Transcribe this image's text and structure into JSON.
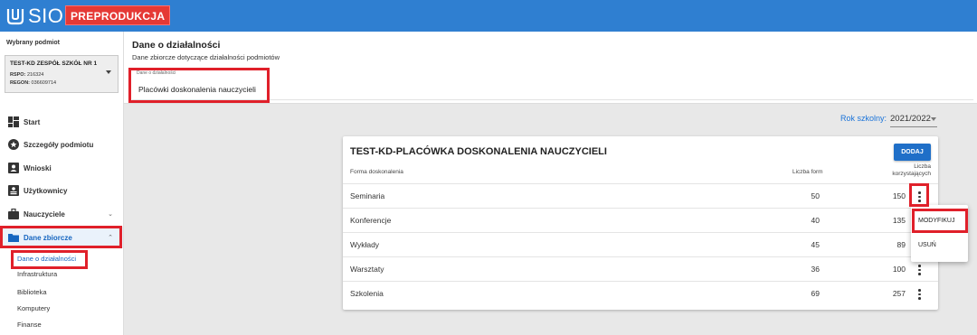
{
  "app": {
    "logo_text": "SIO",
    "environment_badge": "PREPRODUKCJA",
    "brand_color": "#2f7fd1",
    "badge_color": "#e53935"
  },
  "sidebar": {
    "caption": "Wybrany podmiot",
    "entity": {
      "name": "TEST-KD ZESPÓŁ SZKÓŁ NR 1",
      "rspo_label": "RSPO:",
      "rspo_value": "216324",
      "regon_label": "REGON:",
      "regon_value": "036609714"
    },
    "nav": [
      {
        "label": "Start",
        "icon": "dashboard-icon"
      },
      {
        "label": "Szczegóły podmiotu",
        "icon": "star-badge-icon"
      },
      {
        "label": "Wnioski",
        "icon": "person-card-icon"
      },
      {
        "label": "Użytkownicy",
        "icon": "id-badge-icon"
      },
      {
        "label": "Nauczyciele",
        "icon": "briefcase-icon",
        "expandable": true
      },
      {
        "label": "Dane zbiorcze",
        "icon": "folder-icon",
        "expandable": true,
        "expanded": true,
        "active": true
      }
    ],
    "subnav": [
      {
        "label": "Dane o działalności",
        "active": true
      },
      {
        "label": "Infrastruktura"
      },
      {
        "label": "Biblioteka"
      },
      {
        "label": "Komputery"
      },
      {
        "label": "Finanse"
      }
    ]
  },
  "header": {
    "title": "Dane o działalności",
    "subtitle": "Dane zbiorcze dotyczące działalności podmiotów",
    "select_caption": "Dane o działalności",
    "select_value": "Placówki doskonalenia nauczycieli"
  },
  "school_year": {
    "label": "Rok szkolny:",
    "value": "2021/2022"
  },
  "card": {
    "title": "TEST-KD-PLACÓWKA DOSKONALENIA NAUCZYCIELI",
    "add_button": "DODAJ",
    "columns": {
      "form": "Forma doskonalenia",
      "count": "Liczba form",
      "users_line1": "Liczba",
      "users_line2": "korzystających"
    },
    "rows": [
      {
        "form": "Seminaria",
        "count": "50",
        "users": "150"
      },
      {
        "form": "Konferencje",
        "count": "40",
        "users": "135"
      },
      {
        "form": "Wykłady",
        "count": "45",
        "users": "89"
      },
      {
        "form": "Warsztaty",
        "count": "36",
        "users": "100"
      },
      {
        "form": "Szkolenia",
        "count": "69",
        "users": "257"
      }
    ]
  },
  "context_menu": {
    "items": [
      "MODYFIKUJ",
      "USUŃ"
    ]
  },
  "highlight_color": "#e0202a"
}
